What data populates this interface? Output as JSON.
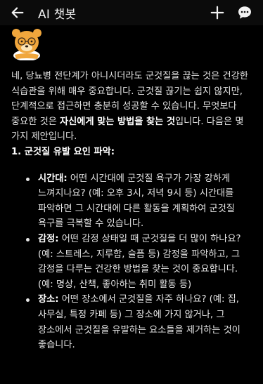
{
  "header": {
    "title": "AI 챗봇"
  },
  "message": {
    "intro_part1": "네, 당뇨병 전단계가 아니시더라도 군것질을 끊는 것은 건강한 식습관을 위해 매우 중요합니다. 군것질 끊기는 쉽지 않지만, 단계적으로 접근하면 충분히 성공할 수 있습니다. 무엇보다 중요한 것은 ",
    "intro_bold": "자신에게 맞는 방법을 찾는 것",
    "intro_part2": "입니다. 다음은 몇 가지 제안입니다.",
    "section_title": "1. 군것질 유발 요인 파악:",
    "items": [
      {
        "label": "시간대:",
        "text": " 어떤 시간대에 군것질 욕구가 가장 강하게 느껴지나요? (예: 오후 3시, 저녁 9시 등) 시간대를 파악하면 그 시간대에 다른 활동을 계획하여 군것질 욕구를 극복할 수 있습니다."
      },
      {
        "label": "감정:",
        "text": " 어떤 감정 상태일 때 군것질을 더 많이 하나요? (예: 스트레스, 지루함, 슬픔 등) 감정을 파악하고, 그 감정을 다루는 건강한 방법을 찾는 것이 중요합니다. (예: 명상, 산책, 좋아하는 취미 활동 등)"
      },
      {
        "label": "장소:",
        "text": " 어떤 장소에서 군것질을 자주 하나요? (예: 집, 사무실, 특정 카페 등) 그 장소에 가지 않거나, 그 장소에서 군것질을 유발하는 요소들을 제거하는 것이 좋습니다."
      }
    ]
  },
  "icons": {
    "back": "arrow-left-icon",
    "new_chat": "plus-icon",
    "chat": "chat-bubble-icon",
    "avatar": "bear-character-avatar"
  },
  "colors": {
    "background": "#000000",
    "text": "#e6e6e6",
    "avatar_fur": "#f0a63c"
  }
}
